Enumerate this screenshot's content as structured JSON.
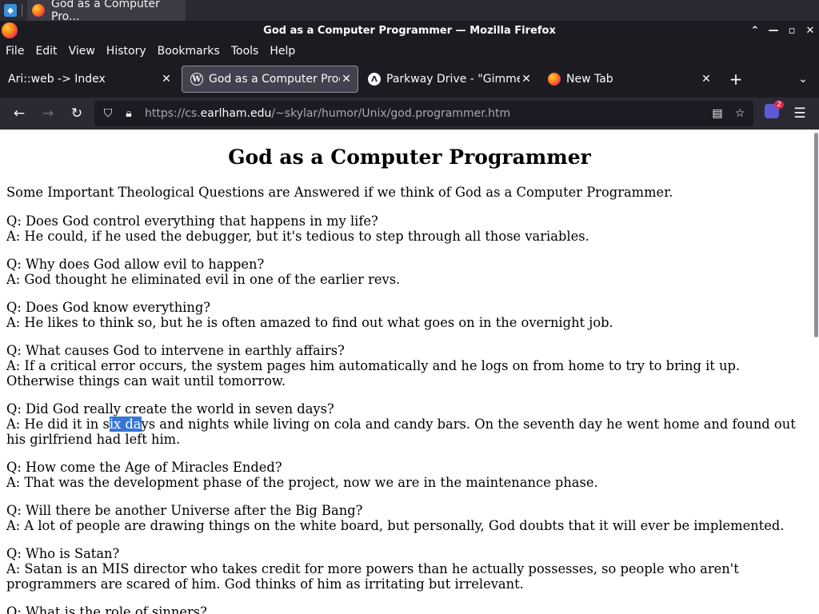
{
  "taskbar": {
    "task_title": "God as a Computer Pro..."
  },
  "window": {
    "title": "God as a Computer Programmer — Mozilla Firefox"
  },
  "menu": [
    "File",
    "Edit",
    "View",
    "History",
    "Bookmarks",
    "Tools",
    "Help"
  ],
  "tabs": [
    {
      "label": "Ari::web -> Index",
      "icon": "none",
      "active": false
    },
    {
      "label": "God as a Computer Prog",
      "icon": "wordpress-icon",
      "active": true
    },
    {
      "label": "Parkway Drive - \"Gimme",
      "icon": "triangle-logo-icon",
      "active": false
    },
    {
      "label": "New Tab",
      "icon": "firefox-icon",
      "active": false
    }
  ],
  "url": {
    "prefix": "https://cs.",
    "host": "earlham.edu",
    "path": "/~skylar/humor/Unix/god.programmer.htm"
  },
  "extension_badge_count": "2",
  "page": {
    "title": "God as a Computer Programmer",
    "intro": "Some Important Theological Questions are Answered if we think of God as a Computer Programmer.",
    "qa": [
      {
        "q": "Q: Does God control everything that happens in my life?",
        "a": "A: He could, if he used the debugger, but it's tedious to step through all those variables."
      },
      {
        "q": "Q: Why does God allow evil to happen?",
        "a": "A: God thought he eliminated evil in one of the earlier revs."
      },
      {
        "q": "Q: Does God know everything?",
        "a": "A: He likes to think so, but he is often amazed to find out what goes on in the overnight job."
      },
      {
        "q": "Q: What causes God to intervene in earthly affairs?",
        "a": "A: If a critical error occurs, the system pages him automatically and he logs on from home to try to bring it up. Otherwise things can wait until tomorrow."
      },
      {
        "q": "Q: Did God really create the world in seven days?",
        "a_pre": "A: He did it in s",
        "a_sel": "ix da",
        "a_post": "ys and nights while living on cola and candy bars. On the seventh day he went home and found out his girlfriend had left him."
      },
      {
        "q": "Q: How come the Age of Miracles Ended?",
        "a": "A: That was the development phase of the project, now we are in the maintenance phase."
      },
      {
        "q": "Q: Will there be another Universe after the Big Bang?",
        "a": "A: A lot of people are drawing things on the white board, but personally, God doubts that it will ever be implemented."
      },
      {
        "q": "Q: Who is Satan?",
        "a": "A: Satan is an MIS director who takes credit for more powers than he actually possesses, so people who aren't programmers are scared of him. God thinks of him as irritating but irrelevant."
      },
      {
        "q": "Q: What is the role of sinners?",
        "a": ""
      }
    ]
  }
}
